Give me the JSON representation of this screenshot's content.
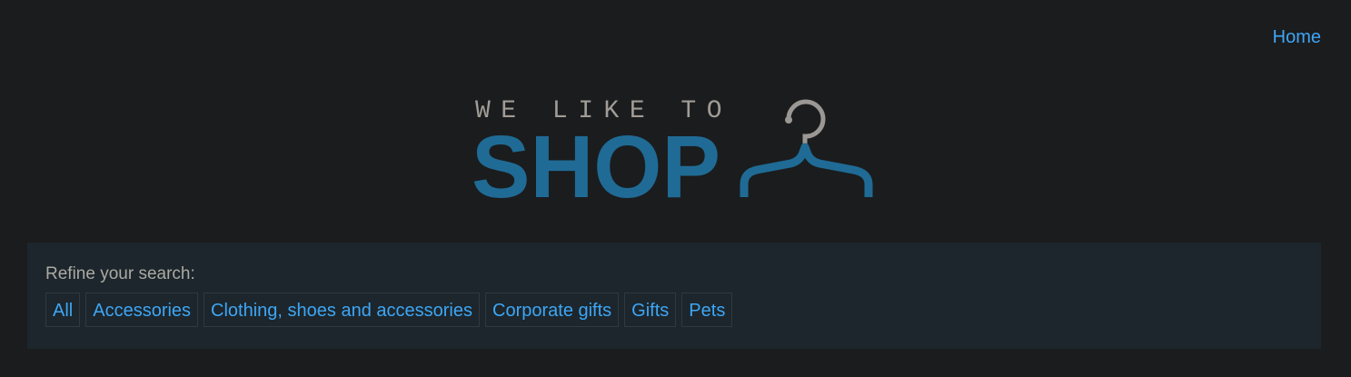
{
  "nav": {
    "home_label": "Home"
  },
  "logo": {
    "tagline": "WE LIKE TO",
    "wordmark": "SHOP",
    "icon": "clothes-hanger-icon",
    "colors": {
      "tagline": "#a09c96",
      "wordmark": "#1f6b95",
      "hanger_hook": "#9a9794",
      "hanger_body": "#1f6b95"
    }
  },
  "refine": {
    "label": "Refine your search:",
    "filters": [
      {
        "label": "All"
      },
      {
        "label": "Accessories"
      },
      {
        "label": "Clothing, shoes and accessories"
      },
      {
        "label": "Corporate gifts"
      },
      {
        "label": "Gifts"
      },
      {
        "label": "Pets"
      }
    ]
  },
  "colors": {
    "background": "#1b1c1e",
    "panel": "#1c262c",
    "link": "#3ea6f5"
  }
}
